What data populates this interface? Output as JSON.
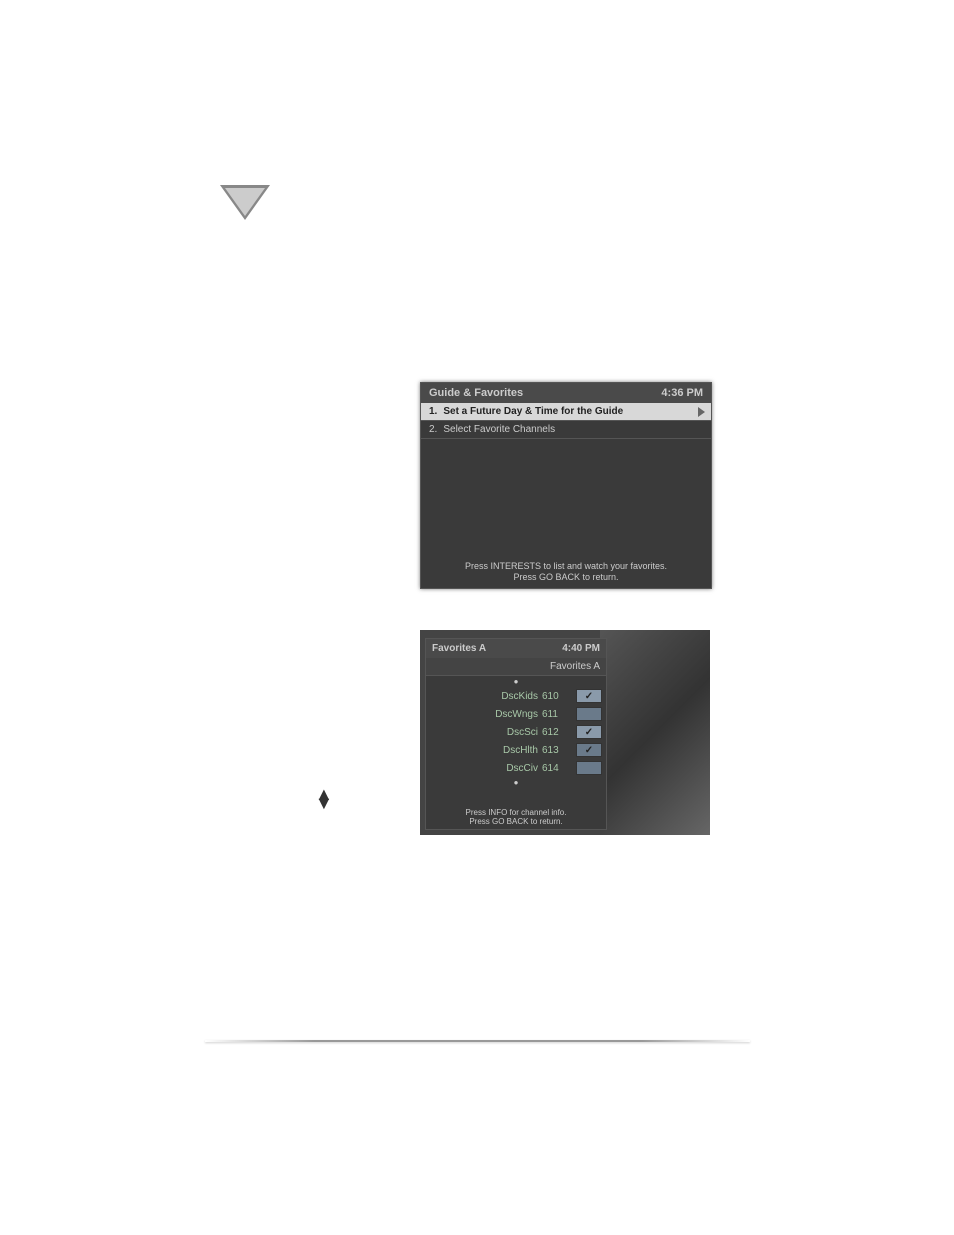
{
  "panel1": {
    "title": "Guide & Favorites",
    "time": "4:36 PM",
    "items": [
      {
        "num": "1.",
        "label": "Set a Future Day & Time for the Guide",
        "selected": true
      },
      {
        "num": "2.",
        "label": "Select Favorite Channels",
        "selected": false
      }
    ],
    "footer1": "Press INTERESTS to list and watch your favorites.",
    "footer2": "Press GO BACK to return."
  },
  "panel2": {
    "title": "Favorites A",
    "time": "4:40 PM",
    "column": "Favorites A",
    "rows": [
      {
        "name": "DscKids",
        "num": "610",
        "checked": true,
        "sel": true
      },
      {
        "name": "DscWngs",
        "num": "611",
        "checked": false,
        "sel": false
      },
      {
        "name": "DscSci",
        "num": "612",
        "checked": true,
        "sel": true
      },
      {
        "name": "DscHlth",
        "num": "613",
        "checked": true,
        "sel": false
      },
      {
        "name": "DscCiv",
        "num": "614",
        "checked": false,
        "sel": false
      }
    ],
    "footer1": "Press INFO for channel info.",
    "footer2": "Press GO BACK to return."
  }
}
